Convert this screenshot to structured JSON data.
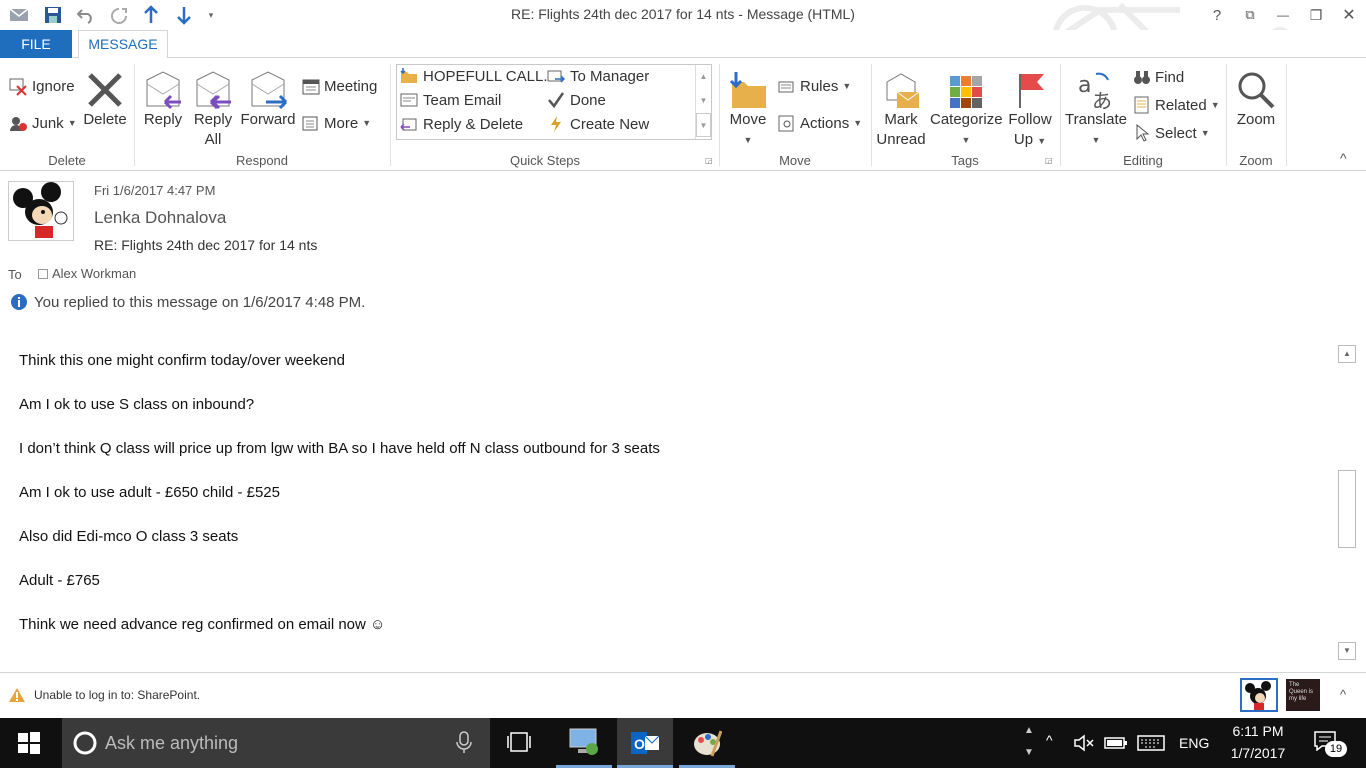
{
  "window": {
    "title": "RE: Flights 24th dec 2017 for 14 nts  - Message (HTML)",
    "help": "?",
    "restore_ribbon": "⧉",
    "minimize": "—",
    "maximize": "❐",
    "close": "✕"
  },
  "tabs": {
    "file": "FILE",
    "message": "MESSAGE"
  },
  "ribbon": {
    "delete_group": {
      "label": "Delete",
      "ignore": "Ignore",
      "junk": "Junk",
      "delete": "Delete"
    },
    "respond_group": {
      "label": "Respond",
      "reply": "Reply",
      "reply_all_1": "Reply",
      "reply_all_2": "All",
      "forward": "Forward",
      "meeting": "Meeting",
      "more": "More"
    },
    "quick_steps": {
      "label": "Quick Steps",
      "items": [
        "HOPEFULL CALL...",
        "To Manager",
        "Team Email",
        "Done",
        "Reply & Delete",
        "Create New"
      ]
    },
    "move_group": {
      "label": "Move",
      "move": "Move",
      "rules": "Rules",
      "actions": "Actions"
    },
    "tags_group": {
      "label": "Tags",
      "mark_unread_1": "Mark",
      "mark_unread_2": "Unread",
      "categorize": "Categorize",
      "follow_up_1": "Follow",
      "follow_up_2": "Up"
    },
    "editing_group": {
      "label": "Editing",
      "translate": "Translate",
      "find": "Find",
      "related": "Related",
      "select": "Select"
    },
    "zoom_group": {
      "label": "Zoom",
      "zoom": "Zoom"
    }
  },
  "message": {
    "date": "Fri 1/6/2017 4:47 PM",
    "sender": "Lenka Dohnalova",
    "subject": "RE: Flights 24th dec 2017 for 14 nts",
    "to_label": "To",
    "to_name": "Alex Workman",
    "info": "You replied to this message on 1/6/2017 4:48 PM.",
    "body": [
      "Think this one might confirm today/over weekend",
      "Am I ok to use S class on inbound?",
      "I don’t think Q class will price up from lgw with BA so I have held off N class outbound for 3 seats",
      "Am I ok to use adult - £650 child - £525",
      "Also did Edi-mco O class 3 seats",
      "Adult - £765",
      "Think we need advance reg confirmed on email now ☺"
    ]
  },
  "statusbar": {
    "warning": "Unable to log in to: SharePoint.",
    "thumb2_text": "The Queen is my life"
  },
  "taskbar": {
    "search_placeholder": "Ask me anything",
    "language": "ENG",
    "time": "6:11 PM",
    "date": "1/7/2017",
    "notifications": "19"
  },
  "colors": {
    "accent": "#1f6dbd",
    "taskbar": "#101010"
  }
}
